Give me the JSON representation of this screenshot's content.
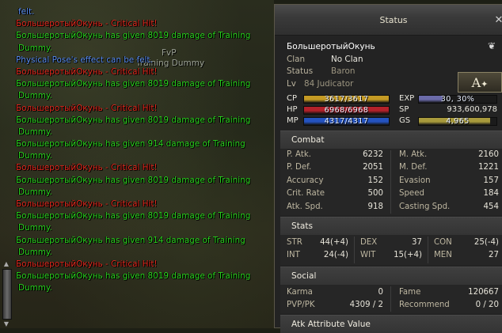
{
  "chat": {
    "lines": [
      {
        "text": "felt.",
        "color": "blue",
        "indent": true
      },
      {
        "text": "БольшеротыйОкунь - Critical Hit!",
        "color": "red"
      },
      {
        "text": "БольшеротыйОкунь has given 8019 damage of Training",
        "color": "green"
      },
      {
        "text": "Dummy.",
        "color": "green",
        "indent": true
      },
      {
        "text": "Physical Pose's effect can be felt.",
        "color": "blue"
      },
      {
        "text": "БольшеротыйОкунь - Critical Hit!",
        "color": "red"
      },
      {
        "text": "БольшеротыйОкунь has given 8019 damage of Training",
        "color": "green"
      },
      {
        "text": "Dummy.",
        "color": "green",
        "indent": true
      },
      {
        "text": "БольшеротыйОкунь - Critical Hit!",
        "color": "red"
      },
      {
        "text": "БольшеротыйОкунь has given 8019 damage of Training",
        "color": "green"
      },
      {
        "text": "Dummy.",
        "color": "green",
        "indent": true
      },
      {
        "text": "БольшеротыйОкунь has given 914 damage of Training",
        "color": "green"
      },
      {
        "text": "Dummy.",
        "color": "green",
        "indent": true
      },
      {
        "text": "БольшеротыйОкунь - Critical Hit!",
        "color": "red"
      },
      {
        "text": "БольшеротыйОкунь has given 8019 damage of Training",
        "color": "green"
      },
      {
        "text": "Dummy.",
        "color": "green",
        "indent": true
      },
      {
        "text": "БольшеротыйОкунь - Critical Hit!",
        "color": "red"
      },
      {
        "text": "БольшеротыйОкунь has given 8019 damage of Training",
        "color": "green"
      },
      {
        "text": "Dummy.",
        "color": "green",
        "indent": true
      },
      {
        "text": "БольшеротыйОкунь has given 914 damage of Training",
        "color": "green"
      },
      {
        "text": "Dummy.",
        "color": "green",
        "indent": true
      },
      {
        "text": "БольшеротыйОкунь - Critical Hit!",
        "color": "red"
      },
      {
        "text": "БольшеротыйОкунь has given 8019 damage of Training",
        "color": "green"
      },
      {
        "text": "Dummy.",
        "color": "green",
        "indent": true
      }
    ]
  },
  "world": {
    "target_tag": "FvP",
    "target_name": "Training Dummy"
  },
  "status": {
    "title": "Status",
    "close_icon": "close-icon",
    "char_name": "БольшеротыйОкунь",
    "clan_label": "Clan",
    "clan_value": "No Clan",
    "status_label": "Status",
    "status_value": "Baron",
    "lv_label": "Lv",
    "level": "84",
    "class_name": "Judicator",
    "lv_class": "84 Judicator",
    "rank_button_label": "A",
    "bars": {
      "cp": {
        "label": "CP",
        "text": "3617/3617",
        "fill": 1.0,
        "color": "#c49a24"
      },
      "hp": {
        "label": "HP",
        "text": "6968/6968",
        "fill": 1.0,
        "color": "#b3212a"
      },
      "mp": {
        "label": "MP",
        "text": "4317/4317",
        "fill": 1.0,
        "color": "#2453c0"
      },
      "exp": {
        "label": "EXP",
        "text": "30, 30%",
        "fill": 0.303,
        "color": "#6a6aa8"
      },
      "sp": {
        "label": "SP",
        "value": "933,600,978"
      },
      "gs": {
        "label": "GS",
        "text": "4,965",
        "fill": 0.92,
        "color": "#a89a3c"
      }
    }
  },
  "combat": {
    "title": "Combat",
    "left": [
      {
        "label": "P. Atk.",
        "value": "6232"
      },
      {
        "label": "P. Def.",
        "value": "2051"
      },
      {
        "label": "Accuracy",
        "value": "152"
      },
      {
        "label": "Crit. Rate",
        "value": "500"
      },
      {
        "label": "Atk. Spd.",
        "value": "918"
      }
    ],
    "right": [
      {
        "label": "M. Atk.",
        "value": "2160"
      },
      {
        "label": "M. Def.",
        "value": "1221"
      },
      {
        "label": "Evasion",
        "value": "157"
      },
      {
        "label": "Speed",
        "value": "184"
      },
      {
        "label": "Casting Spd.",
        "value": "454"
      }
    ]
  },
  "stats": {
    "title": "Stats",
    "cols": [
      [
        {
          "label": "STR",
          "value": "44(+4)"
        },
        {
          "label": "INT",
          "value": "24(-4)"
        }
      ],
      [
        {
          "label": "DEX",
          "value": "37"
        },
        {
          "label": "WIT",
          "value": "15(+4)"
        }
      ],
      [
        {
          "label": "CON",
          "value": "25(-4)"
        },
        {
          "label": "MEN",
          "value": "27"
        }
      ]
    ]
  },
  "social": {
    "title": "Social",
    "left": [
      {
        "label": "Karma",
        "value": "0"
      },
      {
        "label": "PVP/PK",
        "value": "4309 / 2"
      }
    ],
    "right": [
      {
        "label": "Fame",
        "value": "120667"
      },
      {
        "label": "Recommend",
        "value": "0 / 20"
      }
    ]
  },
  "attribute": {
    "title": "Atk Attribute Value"
  }
}
